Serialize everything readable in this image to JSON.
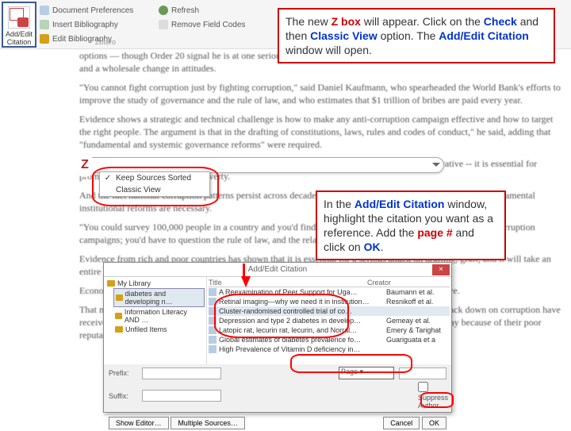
{
  "ribbon": {
    "citation_btn_line1": "Add/Edit",
    "citation_btn_line2": "Citation",
    "items": {
      "doc_prefs": "Document Preferences",
      "insert_bib": "Insert Bibliography",
      "edit_bib": "Edit Bibliography",
      "refresh": "Refresh",
      "remove_codes": "Remove Field Codes"
    },
    "group_label": "Zotero"
  },
  "callout1": {
    "t1": "The new ",
    "z": "Z box",
    "t2": " will appear.  Click on the ",
    "chk": "Check",
    "t3": " and then ",
    "cv": "Classic View",
    "t4": " option.  The ",
    "aec": "Add/Edit Citation",
    "t5": " window will open."
  },
  "callout2": {
    "t1": "In the ",
    "aec": "Add/Edit Citation",
    "t2": " window, highlight the citation you want as a reference.  Add the ",
    "pg": "page #",
    "t3": " and click on ",
    "ok": "OK",
    "t4": "."
  },
  "zmenu": {
    "item1": "Keep Sources Sorted",
    "item2": "Classic View"
  },
  "dialog": {
    "title": "Add/Edit Citation",
    "tree": {
      "root": "My Library",
      "node1": "diabetes and developing n…",
      "node2": "Information Literacy AND …",
      "node3": "Unfiled Items"
    },
    "list": {
      "hdr_title": "Title",
      "hdr_creator": "Creator",
      "rows": [
        {
          "t": "A Reexamination of Peer Support for Uga…",
          "c": "Baumann et al."
        },
        {
          "t": "Retinal imaging—why we need it in institution…",
          "c": "Resnikoff et al."
        },
        {
          "t": "Cluster-randomised controlled trial of co…",
          "c": ""
        },
        {
          "t": "Depression and type 2 diabetes in develop…",
          "c": "Gemeay et al."
        },
        {
          "t": "Latopic rat, lecurin rat, lecurin, and Norral…",
          "c": "Emery & Tarighat"
        },
        {
          "t": "Global estimates of diabetes prevalence fo…",
          "c": "Guariguata et a"
        },
        {
          "t": "High Prevalence of Vitamin D deficiency in…",
          "c": ""
        }
      ]
    },
    "foot": {
      "prefix": "Prefix:",
      "suffix": "Suffix:",
      "page_label": "Page",
      "suppress": "Suppress Author",
      "show_editor": "Show Editor…",
      "multiple": "Multiple Sources…",
      "cancel": "Cancel",
      "ok": "OK"
    }
  },
  "doc": {
    "p1": "options — though Order 20 signal he is at one serious about tackling corruption will require institutional fundamental reform and a wholesale change in attitudes.",
    "p2": "\"You cannot fight corruption just by fighting corruption,\" said Daniel Kaufmann, who spearheaded the World Bank's efforts to improve the study of governance and the rule of law, and who estimates that $1 trillion of bribes are paid every year.",
    "p3": "Evidence shows a strategic and technical challenge is how to make any anti-corruption campaign effective and how to target the right people. The argument is that in the drafting of constitutions, laws, rules and codes of conduct,\" he said, adding that \"fundamental and systemic governance reforms\" were required.",
    "p4": "Economists who specialize in governance say the evidence suggests corruption is a moral imperative -- it is essential for promoting growth and fighting poverty.",
    "p5": "And the fact national corruption patterns persist across decades, despite repeated clean-up efforts, suggests fundamental institutional reforms are necessary.",
    "p6": "\"You could survey 100,000 people in a country and you'd find that half of them have spearheaded major anti-corruption campaigns; you'd have to question the rule of law, and the related issue of property rights,\" said Kaufmann.",
    "p7": "Evidence from rich and poor countries has shown that it is essential for a serious attack on drafting, graft, and it will take an entire generation.",
    "p8": "Economists say the evidence suggests that corruption undermines growth and is a moral imperative.",
    "p9": "That makes some who trade it a bit of a cycle, and being where have made a serious attempt to crack down on corruption have received real economic benefits in return. And southeast Asia's laggards have driven investors away because of their poor reputation."
  }
}
